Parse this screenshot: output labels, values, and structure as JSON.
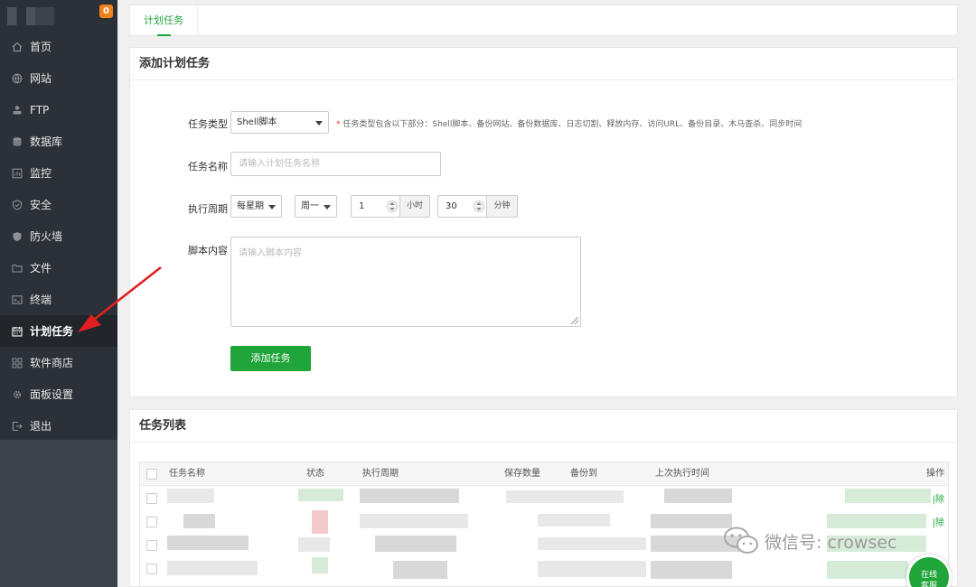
{
  "sidebar": {
    "badge": "0",
    "items": [
      {
        "label": "首页",
        "icon": "home-icon"
      },
      {
        "label": "网站",
        "icon": "globe-icon"
      },
      {
        "label": "FTP",
        "icon": "ftp-icon"
      },
      {
        "label": "数据库",
        "icon": "database-icon"
      },
      {
        "label": "监控",
        "icon": "monitor-icon"
      },
      {
        "label": "安全",
        "icon": "shield-icon"
      },
      {
        "label": "防火墙",
        "icon": "firewall-icon"
      },
      {
        "label": "文件",
        "icon": "folder-icon"
      },
      {
        "label": "终端",
        "icon": "terminal-icon"
      },
      {
        "label": "计划任务",
        "icon": "calendar-icon",
        "active": true
      },
      {
        "label": "软件商店",
        "icon": "apps-icon"
      },
      {
        "label": "面板设置",
        "icon": "gear-icon"
      },
      {
        "label": "退出",
        "icon": "logout-icon"
      }
    ]
  },
  "tabs": {
    "active": "计划任务"
  },
  "add_task": {
    "title": "添加计划任务",
    "type_label": "任务类型",
    "type_value": "Shell脚本",
    "type_note": "任务类型包含以下部分：Shell脚本、备份网站、备份数据库、日志切割、释放内存、访问URL、备份目录、木马查杀、同步时间",
    "name_label": "任务名称",
    "name_placeholder": "请输入计划任务名称",
    "period_label": "执行周期",
    "period_value": "每星期",
    "weekday_value": "周一",
    "hour_value": "1",
    "hour_unit": "小时",
    "minute_value": "30",
    "minute_unit": "分钟",
    "script_label": "脚本内容",
    "script_placeholder": "请输入脚本内容",
    "submit": "添加任务"
  },
  "task_list": {
    "title": "任务列表",
    "columns": [
      "任务名称",
      "状态",
      "执行周期",
      "保存数量",
      "备份到",
      "上次执行时间",
      "操作"
    ],
    "row_action": "删除",
    "row_action_visible": "|除"
  },
  "watermark": "微信号: crowsec",
  "float_button": [
    "在线",
    "客服"
  ],
  "colors": {
    "accent": "#20a53a",
    "sidebar": "#2c3138",
    "badge": "#f0821e",
    "arrow": "#e02020"
  }
}
